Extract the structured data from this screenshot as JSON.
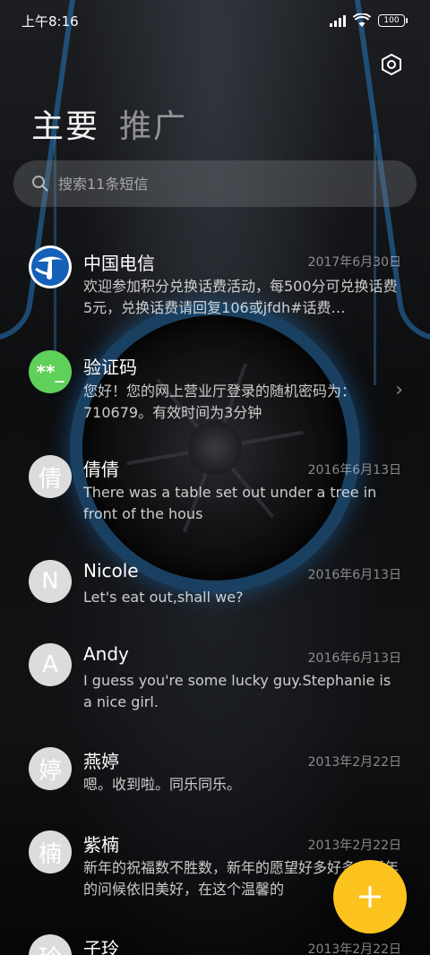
{
  "status": {
    "time": "上午8:16",
    "battery": "100"
  },
  "header": {
    "tabs": [
      {
        "label": "主要"
      },
      {
        "label": "推广"
      }
    ]
  },
  "search": {
    "placeholder": "搜索11条短信"
  },
  "icons": {
    "settings": "hexagon-settings-icon",
    "search": "search-icon",
    "compose": "plus-icon",
    "chevron": "chevron-right-icon"
  },
  "colors": {
    "fab": "#fcc31f",
    "verify_avatar": "#5fd05a",
    "telecom_blue": "#1560b8"
  },
  "conversations": [
    {
      "name": "中国电信",
      "date": "2017年6月30日",
      "avatar": "",
      "preview": "欢迎参加积分兑换话费活动，每500分可兑换话费5元，兑换话费请回复106或jfdh#话费…"
    },
    {
      "name": "验证码",
      "date": "",
      "avatar": "**_",
      "preview": "您好！您的网上营业厅登录的随机密码为：710679。有效时间为3分钟"
    },
    {
      "name": "倩倩",
      "date": "2016年6月13日",
      "avatar": "倩",
      "preview": "There was a table set out under a tree in front of the hous"
    },
    {
      "name": "Nicole",
      "date": "2016年6月13日",
      "avatar": "N",
      "preview": "Let's eat out,shall we?"
    },
    {
      "name": "Andy",
      "date": "2016年6月13日",
      "avatar": "A",
      "preview": "I guess you're some lucky guy.Stephanie is a nice girl."
    },
    {
      "name": "燕婷",
      "date": "2013年2月22日",
      "avatar": "婷",
      "preview": "嗯。收到啦。同乐同乐。"
    },
    {
      "name": "紫楠",
      "date": "2013年2月22日",
      "avatar": "楠",
      "preview": "新年的祝福数不胜数，新年的愿望好多好多，新年的问候依旧美好，在这个温馨的"
    },
    {
      "name": "子玲",
      "date": "2013年2月22日",
      "avatar": "玲",
      "preview": ""
    }
  ]
}
